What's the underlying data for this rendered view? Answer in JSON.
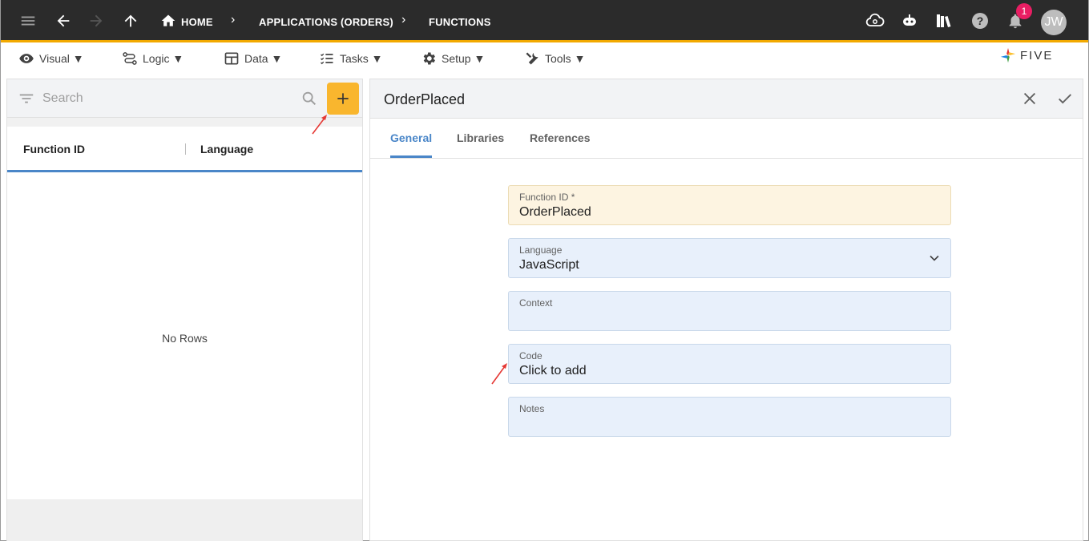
{
  "topbar": {
    "breadcrumbs": [
      "HOME",
      "APPLICATIONS (ORDERS)",
      "FUNCTIONS"
    ],
    "notification_count": "1",
    "avatar_initials": "JW"
  },
  "menubar": {
    "items": [
      "Visual ▼",
      "Logic ▼",
      "Data ▼",
      "Tasks ▼",
      "Setup ▼",
      "Tools ▼"
    ],
    "logo_text": "FIVE"
  },
  "list": {
    "search_placeholder": "Search",
    "columns": [
      "Function ID",
      "Language"
    ],
    "empty_text": "No Rows"
  },
  "form": {
    "title": "OrderPlaced",
    "tabs": [
      "General",
      "Libraries",
      "References"
    ],
    "fields": [
      {
        "label": "Function ID *",
        "value": "OrderPlaced"
      },
      {
        "label": "Language",
        "value": "JavaScript"
      },
      {
        "label": "Context",
        "value": ""
      },
      {
        "label": "Code",
        "value": "Click to add"
      },
      {
        "label": "Notes",
        "value": ""
      }
    ]
  },
  "colors": {
    "accent": "#f9b62e",
    "topbar": "#2b2b2b",
    "tab_active": "#4a86c8",
    "badge": "#e91e63",
    "annotation_arrow": "#e53935"
  }
}
